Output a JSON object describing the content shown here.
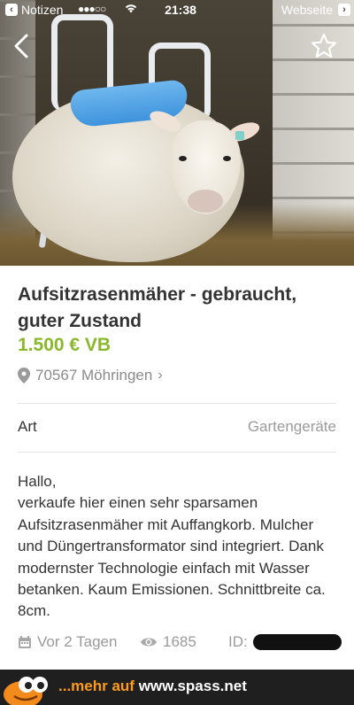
{
  "status_bar": {
    "back_app": "Notizen",
    "signal": "●●●○○",
    "time": "21:38",
    "right_app": "Webseite"
  },
  "nav": {
    "back_icon": "chevron-left-icon",
    "favorite_icon": "star-outline-icon"
  },
  "listing": {
    "title": "Aufsitzrasenmäher - gebraucht, guter Zustand",
    "price": "1.500 € VB",
    "location": "70567 Möhringen",
    "attribute": {
      "label": "Art",
      "value": "Gartengeräte"
    },
    "description": "Hallo,\nverkaufe hier einen sehr sparsamen Aufsitzrasenmäher mit Auffangkorb. Mulcher und Düngertransformator sind integriert. Dank modernster Technologie einfach mit Wasser betanken. Kaum Emissionen. Schnittbreite ca. 8cm.",
    "posted": "Vor 2 Tagen",
    "views": "1685",
    "id_label": "ID:"
  },
  "footer": {
    "text": "...mehr auf",
    "site": "www.spass.net"
  },
  "colors": {
    "price": "#8ab82b",
    "footer_accent": "#ff9a1a"
  }
}
